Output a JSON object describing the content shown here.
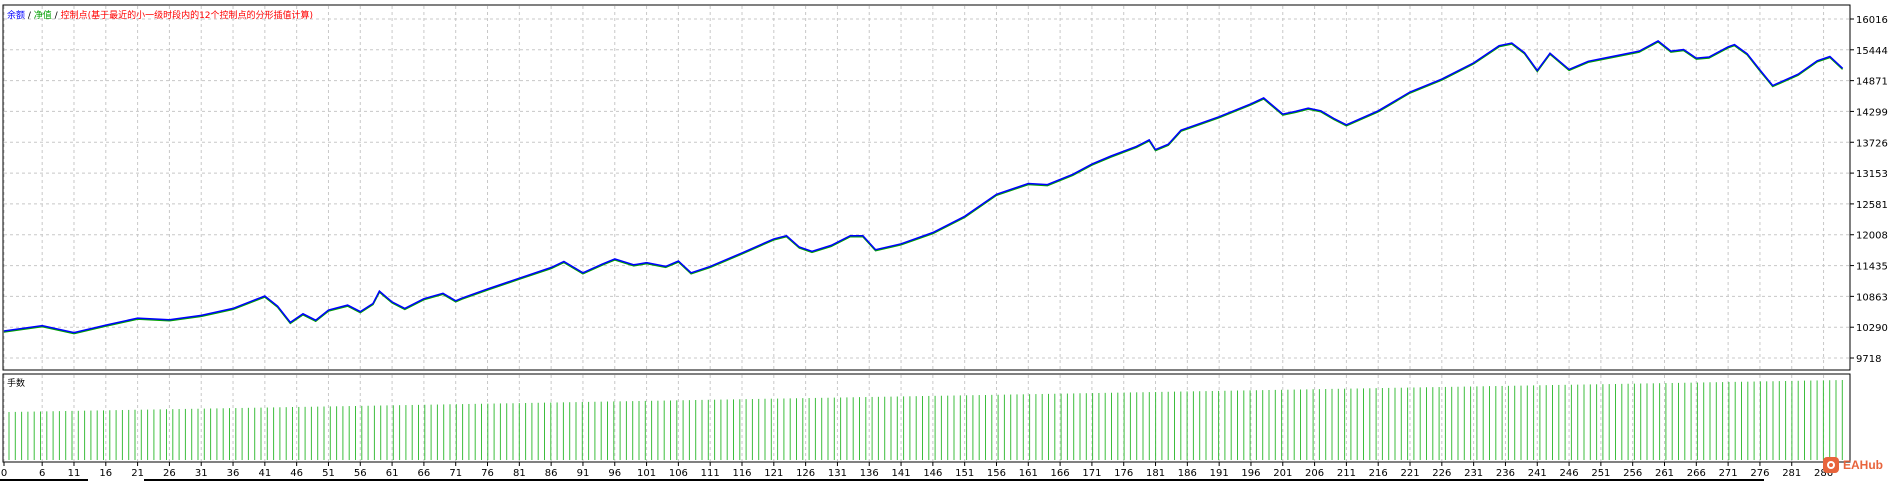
{
  "legend": {
    "balance_label": "余额",
    "sep1": " / ",
    "equity_label": "净值",
    "sep2": " / ",
    "note": "控制点(基于最近的小一级时段内的12个控制点的分形插值计算)",
    "colors": {
      "balance": "#0000ff",
      "equity": "#00a000",
      "note": "#ff0000",
      "sep": "#000000"
    }
  },
  "volume_panel": {
    "label": "手数",
    "bar_color": "#3cbe3c"
  },
  "watermark": {
    "text": "EAHub"
  },
  "chart_data": [
    {
      "type": "line",
      "series": [
        {
          "name": "余额",
          "color": "#0000ff"
        },
        {
          "name": "净值",
          "color": "#00a000"
        }
      ],
      "x": [
        0,
        6,
        11,
        16,
        21,
        26,
        31,
        36,
        41,
        43,
        45,
        47,
        49,
        51,
        54,
        56,
        58,
        59,
        61,
        63,
        66,
        69,
        71,
        72,
        76,
        81,
        86,
        88,
        91,
        94,
        96,
        99,
        101,
        104,
        106,
        108,
        111,
        116,
        121,
        123,
        125,
        127,
        130,
        133,
        135,
        137,
        141,
        146,
        151,
        156,
        161,
        164,
        168,
        171,
        174,
        178,
        180,
        181,
        183,
        185,
        191,
        196,
        198,
        201,
        203,
        205,
        207,
        209,
        211,
        216,
        221,
        226,
        231,
        235,
        237,
        239,
        241,
        243,
        246,
        249,
        252,
        257,
        260,
        262,
        264,
        266,
        268,
        271,
        272,
        274,
        276,
        278,
        282,
        285,
        287,
        289
      ],
      "y": [
        10220,
        10320,
        10190,
        10330,
        10460,
        10430,
        10510,
        10640,
        10870,
        10680,
        10380,
        10540,
        10420,
        10610,
        10700,
        10580,
        10730,
        10960,
        10760,
        10640,
        10820,
        10920,
        10780,
        10830,
        11000,
        11200,
        11400,
        11510,
        11300,
        11460,
        11560,
        11450,
        11490,
        11420,
        11520,
        11300,
        11420,
        11670,
        11930,
        11990,
        11780,
        11700,
        11810,
        11990,
        11990,
        11730,
        11840,
        12050,
        12350,
        12760,
        12960,
        12940,
        13130,
        13320,
        13470,
        13650,
        13770,
        13590,
        13690,
        13950,
        14200,
        14440,
        14550,
        14250,
        14300,
        14360,
        14310,
        14170,
        14050,
        14310,
        14660,
        14900,
        15200,
        15520,
        15570,
        15390,
        15060,
        15380,
        15080,
        15230,
        15300,
        15420,
        15610,
        15420,
        15450,
        15290,
        15310,
        15500,
        15540,
        15370,
        15070,
        14780,
        14990,
        15240,
        15320,
        15100
      ],
      "volume": {
        "start": 0.6,
        "end": 1.0
      },
      "ylim": [
        9718,
        16016
      ],
      "yticks": [
        9718,
        10290,
        10863,
        11435,
        12008,
        12581,
        13153,
        13726,
        14299,
        14871,
        15444,
        16016
      ],
      "xlim": [
        0,
        290
      ],
      "xticks": [
        0,
        6,
        11,
        16,
        21,
        26,
        31,
        36,
        41,
        46,
        51,
        56,
        61,
        66,
        71,
        76,
        81,
        86,
        91,
        96,
        101,
        106,
        111,
        116,
        121,
        126,
        131,
        136,
        141,
        146,
        151,
        156,
        161,
        166,
        171,
        176,
        181,
        186,
        191,
        196,
        201,
        206,
        211,
        216,
        221,
        226,
        231,
        236,
        241,
        246,
        251,
        256,
        261,
        266,
        271,
        276,
        281,
        286
      ],
      "grid": true,
      "legend_position": "top-left"
    }
  ]
}
